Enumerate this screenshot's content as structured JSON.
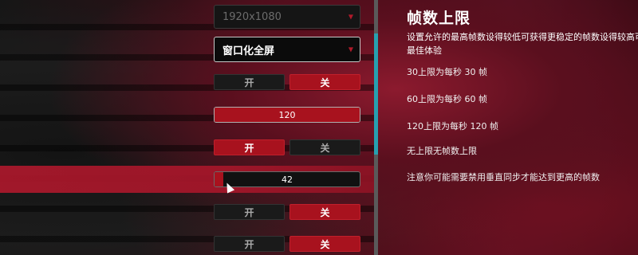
{
  "settings": {
    "resolution": {
      "value": "1920x1080"
    },
    "window_mode": {
      "value": "窗口化全屏"
    },
    "toggle_1": {
      "on_label": "开",
      "off_label": "关",
      "selected": "off"
    },
    "fps_limit": {
      "value": "120",
      "fill_fraction": 1.0
    },
    "toggle_2": {
      "on_label": "开",
      "off_label": "关",
      "selected": "on"
    },
    "slider": {
      "value": "42",
      "fill_fraction": 0.06
    },
    "toggle_3": {
      "on_label": "开",
      "off_label": "关",
      "selected": "off"
    },
    "toggle_4": {
      "on_label": "开",
      "off_label": "关",
      "selected": "off"
    }
  },
  "info_panel": {
    "title": "帧数上限",
    "description_line1": "设置允许的最高帧数设得较低可获得更稳定的帧数设得较高可在高",
    "description_line2": "最佳体验",
    "options": [
      "30上限为每秒 30 帧",
      "60上限为每秒 60 帧",
      "120上限为每秒 120 帧",
      "无上限无帧数上限"
    ],
    "note": "注意你可能需要禁用垂直同步才能达到更高的帧数"
  },
  "colors": {
    "accent_red": "#a8121e",
    "scrollbar_thumb": "#27a0b0"
  }
}
